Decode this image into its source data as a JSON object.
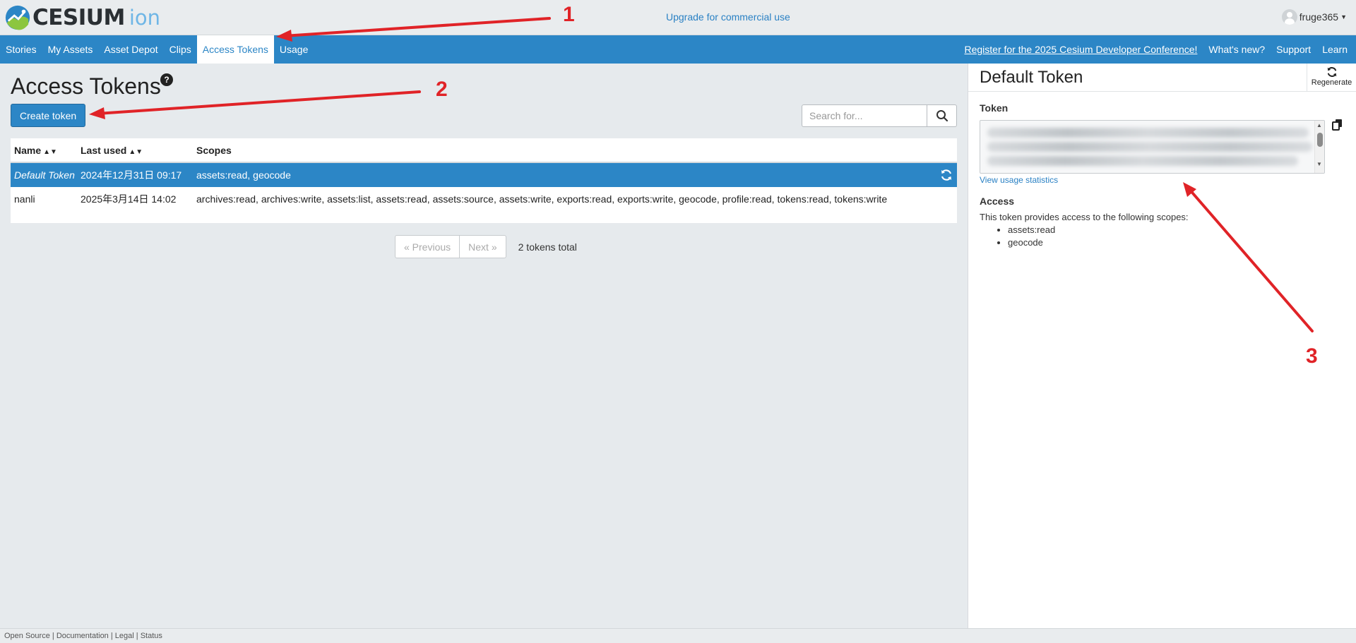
{
  "brand": {
    "logo_text": "CESIUM",
    "logo_sub": "ion"
  },
  "topbar": {
    "upgrade_link": "Upgrade for commercial use",
    "username": "fruge365"
  },
  "nav": {
    "items": [
      "Stories",
      "My Assets",
      "Asset Depot",
      "Clips",
      "Access Tokens",
      "Usage"
    ],
    "active": "Access Tokens",
    "right_items": [
      "Register for the 2025 Cesium Developer Conference!",
      "What's new?",
      "Support",
      "Learn"
    ]
  },
  "page": {
    "title": "Access Tokens",
    "help": "?",
    "create_button": "Create token",
    "search_placeholder": "Search for..."
  },
  "table": {
    "columns": [
      "Name",
      "Last used",
      "Scopes"
    ],
    "rows": [
      {
        "name": "Default Token",
        "last_used": "2024年12月31日 09:17",
        "scopes": "assets:read, geocode",
        "selected": true
      },
      {
        "name": "nanli",
        "last_used": "2025年3月14日 14:02",
        "scopes": "archives:read, archives:write, assets:list, assets:read, assets:source, assets:write, exports:read, exports:write, geocode, profile:read, tokens:read, tokens:write",
        "selected": false
      }
    ]
  },
  "pagination": {
    "prev": "« Previous",
    "next": "Next »",
    "total": "2 tokens total"
  },
  "panel": {
    "title": "Default Token",
    "regenerate": "Regenerate",
    "token_label": "Token",
    "usage_link": "View usage statistics",
    "access_label": "Access",
    "access_desc": "This token provides access to the following scopes:",
    "scopes": [
      "assets:read",
      "geocode"
    ]
  },
  "footer": {
    "links": [
      "Open Source",
      "Documentation",
      "Legal",
      "Status"
    ]
  },
  "annotations": {
    "labels": [
      "1",
      "2",
      "3"
    ],
    "color": "#e02327"
  },
  "colors": {
    "accent": "#2c86c6",
    "link": "#2a81c4"
  }
}
